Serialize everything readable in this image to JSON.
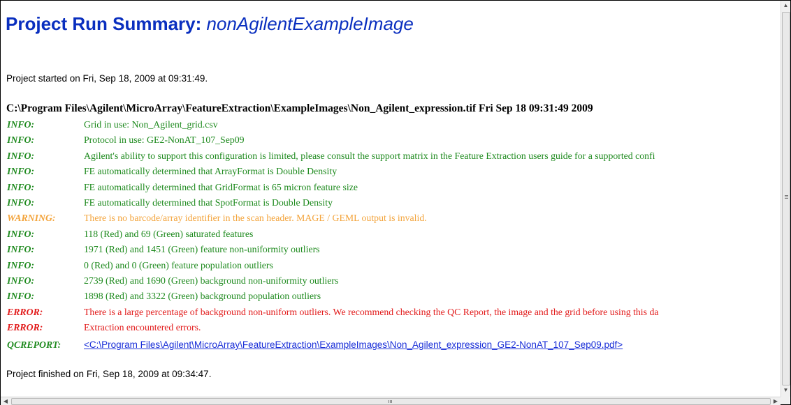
{
  "report": {
    "title_prefix": "Project Run Summary:",
    "title_project": "nonAgilentExampleImage",
    "started": "Project started on Fri, Sep 18, 2009 at 09:31:49.",
    "image_header": "C:\\Program Files\\Agilent\\MicroArray\\FeatureExtraction\\ExampleImages\\Non_Agilent_expression.tif Fri Sep 18 09:31:49 2009",
    "log": [
      {
        "level": "INFO:",
        "type": "info",
        "message": "Grid in use: Non_Agilent_grid.csv"
      },
      {
        "level": "INFO:",
        "type": "info",
        "message": "Protocol in use: GE2-NonAT_107_Sep09"
      },
      {
        "level": "INFO:",
        "type": "info",
        "message": "Agilent's ability to support this configuration is limited, please consult the support matrix in the Feature Extraction users guide for a supported confi"
      },
      {
        "level": "INFO:",
        "type": "info",
        "message": "FE automatically determined that ArrayFormat is Double Density"
      },
      {
        "level": "INFO:",
        "type": "info",
        "message": "FE automatically determined that GridFormat is 65 micron feature size"
      },
      {
        "level": "INFO:",
        "type": "info",
        "message": "FE automatically determined that SpotFormat is Double Density"
      },
      {
        "level": "WARNING:",
        "type": "warning",
        "message": "There is no barcode/array identifier in the scan header. MAGE / GEML output is invalid."
      },
      {
        "level": "INFO:",
        "type": "info",
        "message": "118 (Red) and 69 (Green) saturated features"
      },
      {
        "level": "INFO:",
        "type": "info",
        "message": "1971 (Red) and 1451 (Green) feature non-uniformity outliers"
      },
      {
        "level": "INFO:",
        "type": "info",
        "message": "0 (Red) and 0 (Green) feature population outliers"
      },
      {
        "level": "INFO:",
        "type": "info",
        "message": "2739 (Red) and 1690 (Green) background non-uniformity outliers"
      },
      {
        "level": "INFO:",
        "type": "info",
        "message": "1898 (Red) and 3322 (Green) background population outliers"
      },
      {
        "level": "ERROR:",
        "type": "error",
        "message": "There is a large percentage of background non-uniform outliers. We recommend checking the QC Report, the image and the grid before using this da"
      },
      {
        "level": "ERROR:",
        "type": "error",
        "message": "Extraction encountered errors."
      }
    ],
    "qc": {
      "level": "QCREPORT:",
      "link": "<C:\\Program Files\\Agilent\\MicroArray\\FeatureExtraction\\ExampleImages\\Non_Agilent_expression_GE2-NonAT_107_Sep09.pdf>"
    },
    "finished": "Project finished on Fri, Sep 18, 2009 at 09:34:47."
  },
  "colors": {
    "title": "#0a2fbf",
    "info": "#1e8a1e",
    "warning": "#f3a43c",
    "error": "#e21b1b",
    "link": "#1a2fd8"
  },
  "scrollbars": {
    "up_icon": "scroll-up-arrow",
    "down_icon": "scroll-down-arrow",
    "left_icon": "scroll-left-arrow",
    "right_icon": "scroll-right-arrow"
  }
}
